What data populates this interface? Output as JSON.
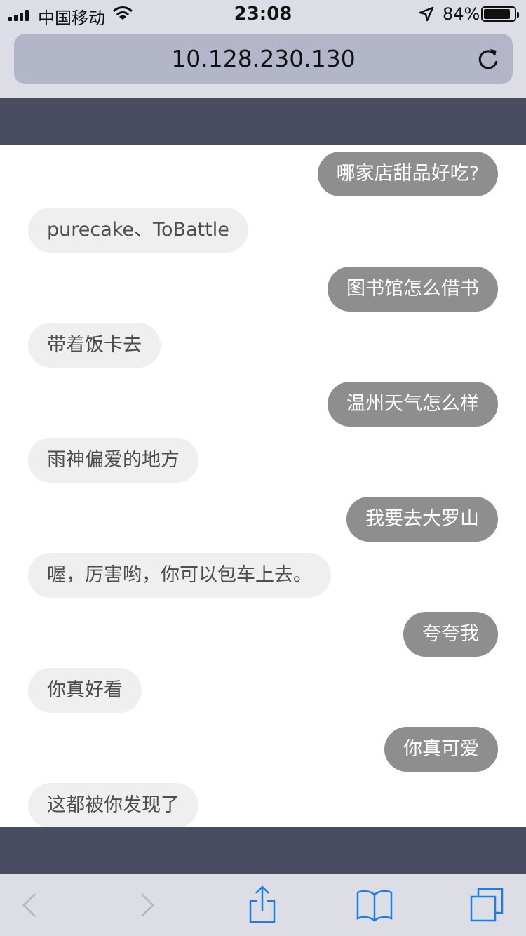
{
  "status_bar": {
    "carrier": "中国移动",
    "time": "23:08",
    "battery_percent": "84%",
    "battery_level": 0.84,
    "icons": [
      "signal-icon",
      "wifi-icon",
      "location-arrow-icon",
      "battery-icon"
    ]
  },
  "browser": {
    "url": "10.128.230.130",
    "reload_icon": "reload-icon"
  },
  "chat": {
    "messages": [
      {
        "sender": "user",
        "text": "哪家店甜品好吃?"
      },
      {
        "sender": "bot",
        "text": "purecake、ToBattle"
      },
      {
        "sender": "user",
        "text": "图书馆怎么借书"
      },
      {
        "sender": "bot",
        "text": "带着饭卡去"
      },
      {
        "sender": "user",
        "text": "温州天气怎么样"
      },
      {
        "sender": "bot",
        "text": "雨神偏爱的地方"
      },
      {
        "sender": "user",
        "text": "我要去大罗山"
      },
      {
        "sender": "bot",
        "text": "喔，厉害哟，你可以包车上去。"
      },
      {
        "sender": "user",
        "text": "夸夸我"
      },
      {
        "sender": "bot",
        "text": "你真好看"
      },
      {
        "sender": "user",
        "text": "你真可爱"
      },
      {
        "sender": "bot",
        "text": "这都被你发现了"
      }
    ]
  },
  "toolbar": {
    "icons": [
      "back-icon",
      "forward-icon",
      "share-icon",
      "bookmarks-icon",
      "tabs-icon"
    ],
    "accent_color": "#1a7ee6",
    "disabled_color": "#b7bac6"
  },
  "colors": {
    "user_bubble": "#8e8e8e",
    "bot_bubble": "#efefef",
    "header_bar": "#4a4c62",
    "chrome": "#dcdde5"
  }
}
